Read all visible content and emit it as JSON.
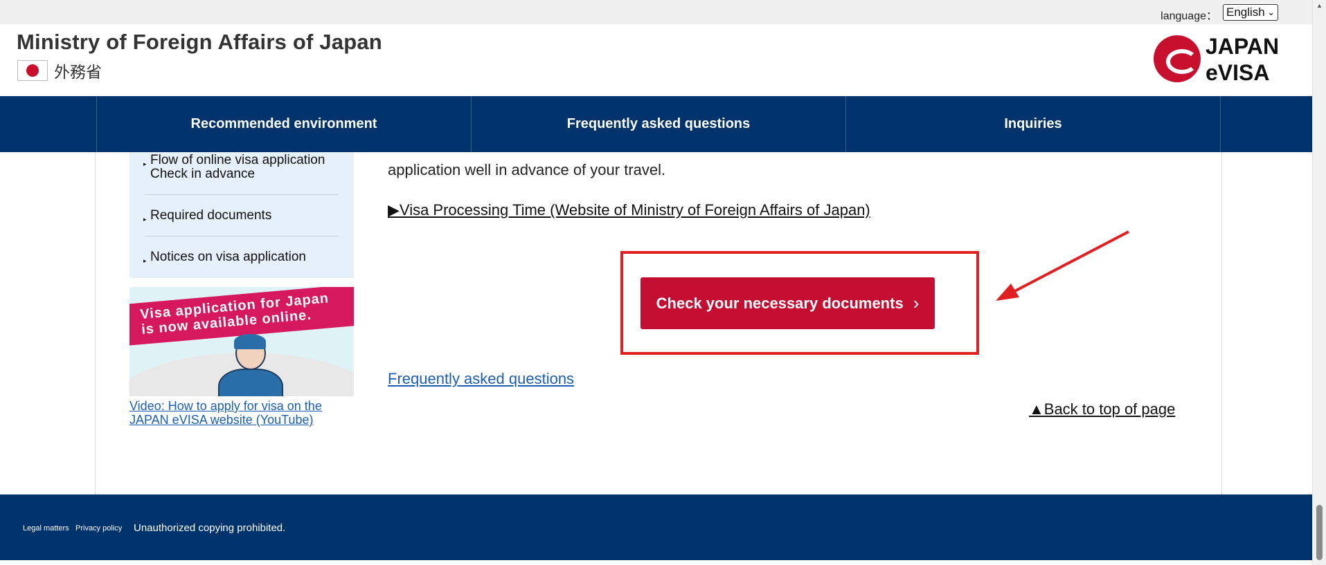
{
  "utility": {
    "language_label": "language：",
    "language_value": "English"
  },
  "header": {
    "ministry_title": "Ministry of Foreign Affairs of Japan",
    "ministry_japanese": "外務省",
    "logo_line1": "JAPAN",
    "logo_line2": "eVISA"
  },
  "nav": {
    "items": [
      {
        "label": "Recommended environment"
      },
      {
        "label": "Frequently asked questions"
      },
      {
        "label": "Inquiries"
      }
    ]
  },
  "sidebar": {
    "items": [
      {
        "label_line1": "Flow of online visa application",
        "label_line2": "Check in advance"
      },
      {
        "label_line1": "Required documents"
      },
      {
        "label_line1": "Notices on visa application"
      }
    ],
    "banner": {
      "line1": "Visa application for Japan",
      "line2": "is  now available online."
    },
    "video_link": "Video: How to apply for visa on the JAPAN eVISA website (YouTube)"
  },
  "main": {
    "body_text": "application well in advance of your travel.",
    "mofa_link": "▶Visa Processing Time (Website of Ministry of Foreign Affairs of Japan)",
    "check_button": "Check your necessary documents",
    "check_button_arrow": "›",
    "faq_link": "Frequently asked questions",
    "back_to_top": "▲Back to top of page"
  },
  "footer": {
    "legal": "Legal matters",
    "privacy": "Privacy policy",
    "copyright": "Unauthorized copying prohibited."
  },
  "colors": {
    "nav_bg": "#00326b",
    "button_red": "#c40f33",
    "highlight_red": "#e02020",
    "link_blue": "#1a5fb4"
  }
}
